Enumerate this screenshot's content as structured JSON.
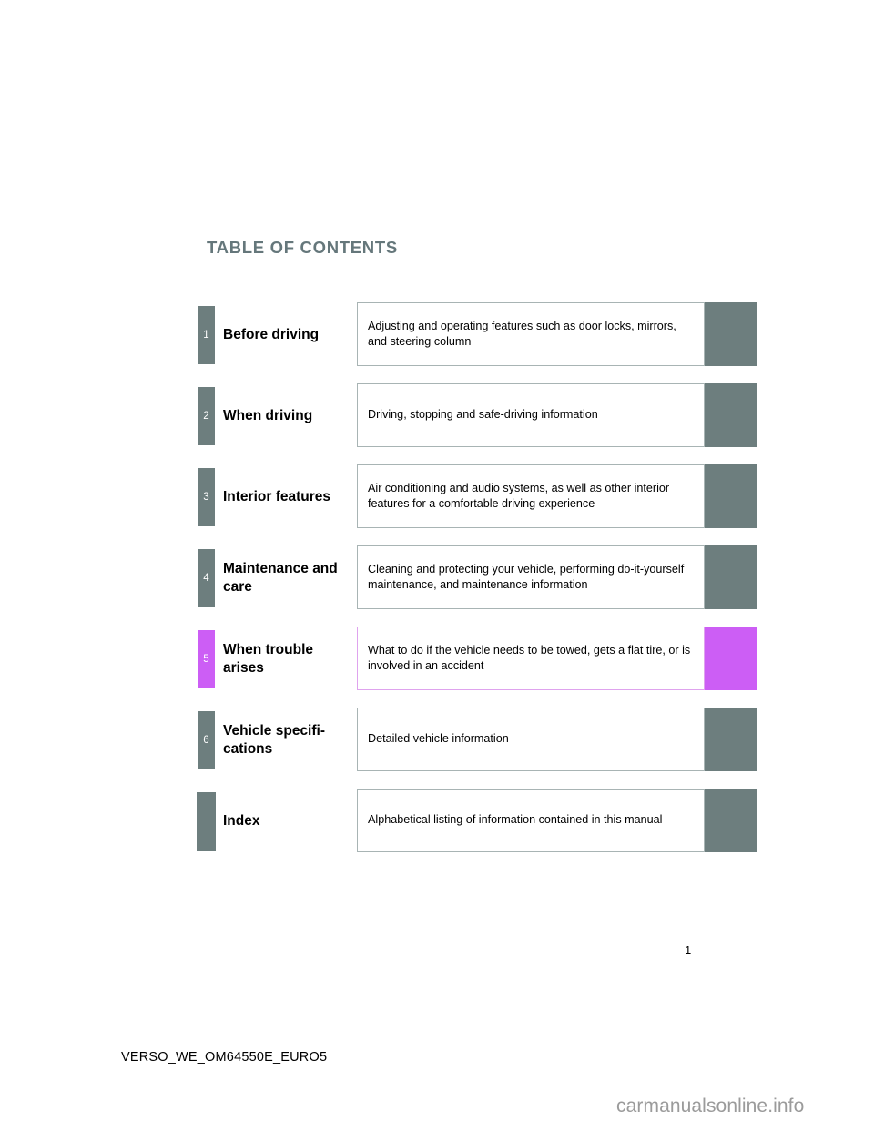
{
  "header": {
    "title": "TABLE OF CONTENTS"
  },
  "colors": {
    "teal": "#6d7e7e",
    "accent_magenta": "#cc5ef5",
    "title_text": "#65777b",
    "box_border": "#a8b4b4",
    "accent_box_border": "#dfa3ee",
    "watermark": "#9b9b9b"
  },
  "contents": {
    "rows": [
      {
        "number": "1",
        "title": "Before driving",
        "description": "Adjusting and operating features such as door locks, mirrors, and steering column",
        "highlighted": false
      },
      {
        "number": "2",
        "title": "When driving",
        "description": "Driving, stopping and safe-driving information",
        "highlighted": false
      },
      {
        "number": "3",
        "title": "Interior features",
        "description": "Air conditioning and audio systems, as well as other interior features for a comfortable driving experience",
        "highlighted": false
      },
      {
        "number": "4",
        "title": "Maintenance and care",
        "description": "Cleaning and protecting your vehicle, performing do-it-yourself maintenance, and maintenance information",
        "highlighted": false
      },
      {
        "number": "5",
        "title": "When trouble arises",
        "description": "What to do if the vehicle needs to be towed, gets a flat tire, or is involved in an accident",
        "highlighted": true
      },
      {
        "number": "6",
        "title": "Vehicle specifi-cations",
        "description": "Detailed vehicle information",
        "highlighted": false
      },
      {
        "number": "",
        "title": "Index",
        "description": "Alphabetical listing of information contained in this manual",
        "highlighted": false
      }
    ]
  },
  "footer": {
    "page_number": "1",
    "document_code": "VERSO_WE_OM64550E_EURO5",
    "watermark": "carmanualsonline.info"
  }
}
